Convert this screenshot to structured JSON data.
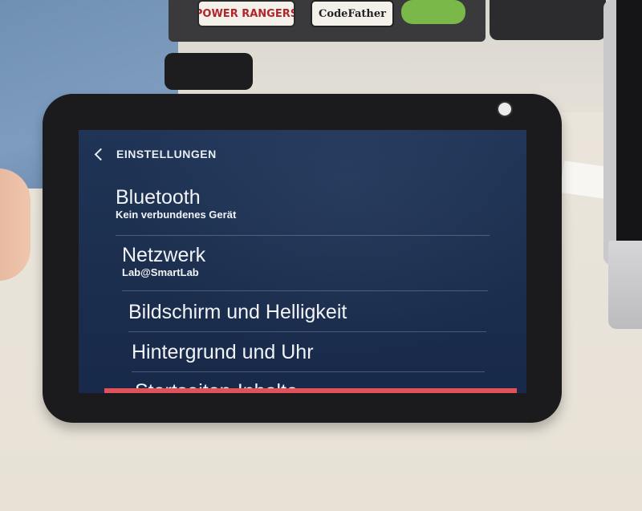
{
  "background": {
    "sticker_1": "POWER RANGERS",
    "sticker_2": "CodeFather",
    "sticker_3": ""
  },
  "screen": {
    "header": {
      "title": "EINSTELLUNGEN",
      "back_icon": "chevron-left-icon"
    },
    "items": [
      {
        "title": "Bluetooth",
        "subtitle": "Kein verbundenes Gerät"
      },
      {
        "title": "Netzwerk",
        "subtitle": "Lab@SmartLab"
      },
      {
        "title": "Bildschirm und Helligkeit",
        "subtitle": ""
      },
      {
        "title": "Hintergrund und Uhr",
        "subtitle": ""
      },
      {
        "title": "Startseiten-Inhalte",
        "subtitle": ""
      }
    ]
  },
  "colors": {
    "screen_bg": "#1f3456",
    "accent": "#e0525a",
    "text": "#f1f3f7"
  }
}
